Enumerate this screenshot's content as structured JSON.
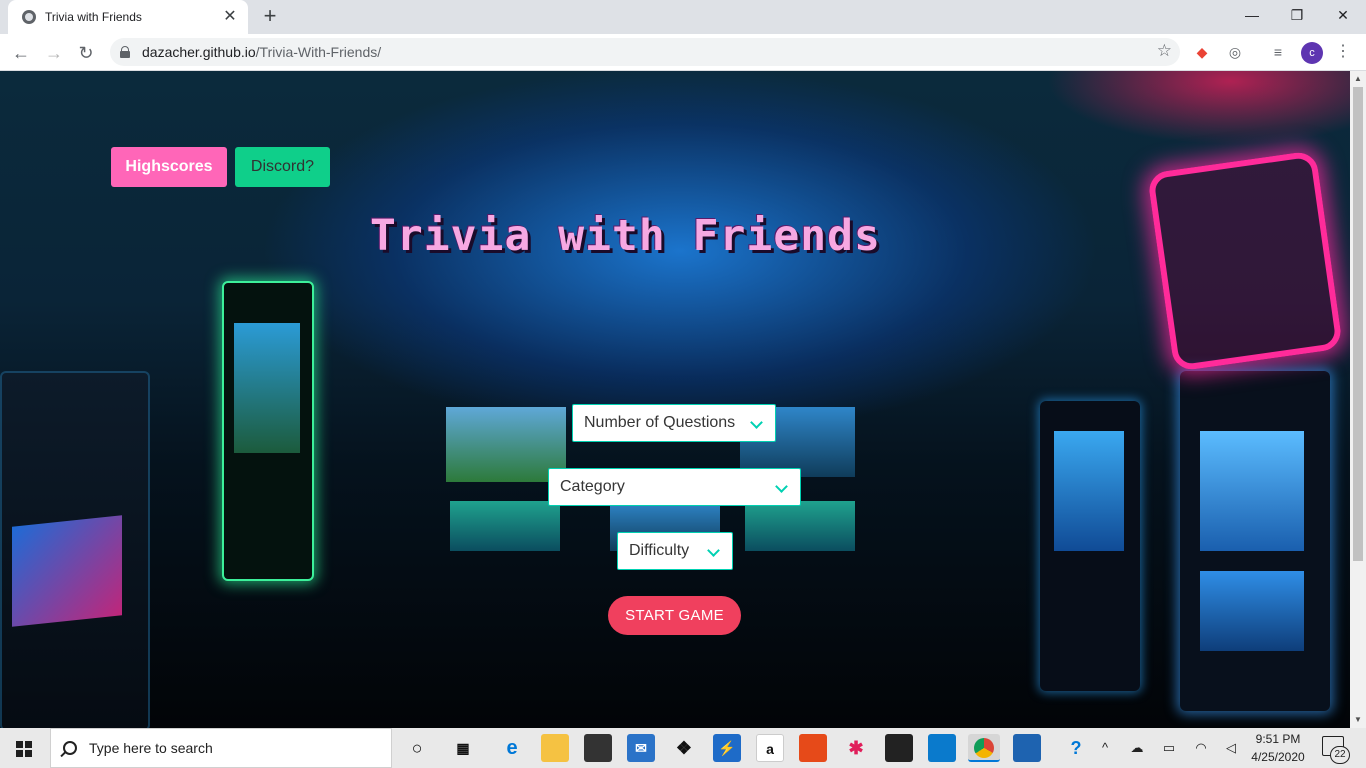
{
  "browser": {
    "tab_title": "Trivia with Friends",
    "tab_close": "✕",
    "new_tab": "+",
    "window_controls": {
      "minimize": "—",
      "restore": "❐",
      "close": "✕"
    },
    "back": "←",
    "forward": "→",
    "reload": "↻",
    "url_host": "dazacher.github.io",
    "url_path": "/Trivia-With-Friends/",
    "bookmark_star": "☆",
    "profile_initial": "c",
    "menu": "⋮"
  },
  "page": {
    "highscores_label": "Highscores",
    "discord_label": "Discord?",
    "title": "Trivia with Friends",
    "questions_select": "Number of Questions",
    "category_select": "Category",
    "difficulty_select": "Difficulty",
    "start_label": "START GAME",
    "colors": {
      "highscores_bg": "#ff66b8",
      "discord_bg": "#0fcf8a",
      "select_border": "#00d1b2",
      "start_bg": "#f0405e",
      "title_fill": "#f7a8e2"
    }
  },
  "taskbar": {
    "search_placeholder": "Type here to search",
    "amazon_glyph": "a",
    "time": "9:51 PM",
    "date": "4/25/2020",
    "notification_count": "22",
    "icons": [
      "cortana-icon",
      "task-view-icon",
      "edge-icon",
      "file-explorer-icon",
      "store-icon",
      "mail-icon",
      "dropbox-icon",
      "powershell-icon",
      "amazon-icon",
      "office-icon",
      "slack-icon",
      "terminal-icon",
      "vscode-icon",
      "chrome-icon",
      "photos-icon",
      "help-icon"
    ]
  }
}
